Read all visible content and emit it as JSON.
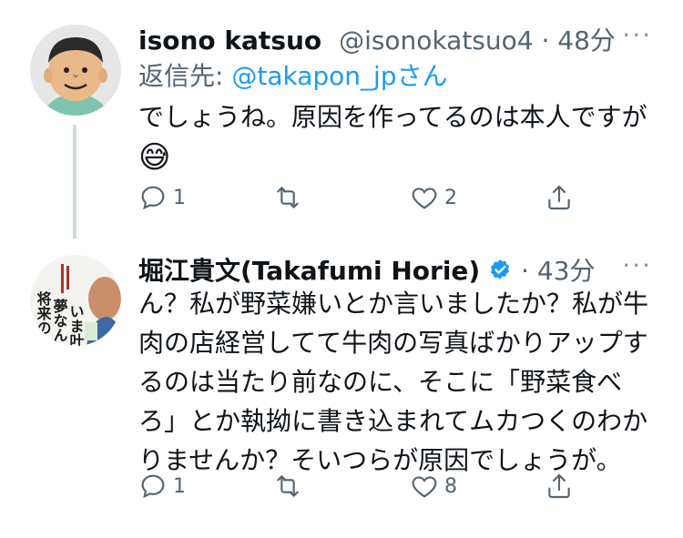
{
  "tweets": [
    {
      "name": "isono katsuo",
      "handle": "@isonokatsuo4",
      "time": "48分",
      "reply_prefix": "返信先: ",
      "reply_mention": "@takapon_jp",
      "reply_suffix": "さん",
      "text": "でしょうね。原因を作ってるのは本人ですが",
      "emoji": "😅",
      "actions": {
        "reply_count": "1",
        "retweet_count": "",
        "like_count": "2"
      }
    },
    {
      "name": "堀江貴文(Takafumi Horie)",
      "verified": true,
      "time": "43分",
      "text": "ん？私が野菜嫌いとか言いましたか？私が牛肉の店経営してて牛肉の写真ばかりアップするのは当たり前なのに、そこに「野菜食べろ」とか執拗に書き込まれてムカつくのわかりませんか？そいつらが原因でしょうが。",
      "avatar_text": "将来の夢なんか、いま叶えろ。",
      "actions": {
        "reply_count": "1",
        "retweet_count": "",
        "like_count": "8"
      }
    }
  ],
  "colors": {
    "accent": "#1d9bf0",
    "muted": "#536471",
    "verified": "#1d9bf0"
  },
  "separator": " · "
}
